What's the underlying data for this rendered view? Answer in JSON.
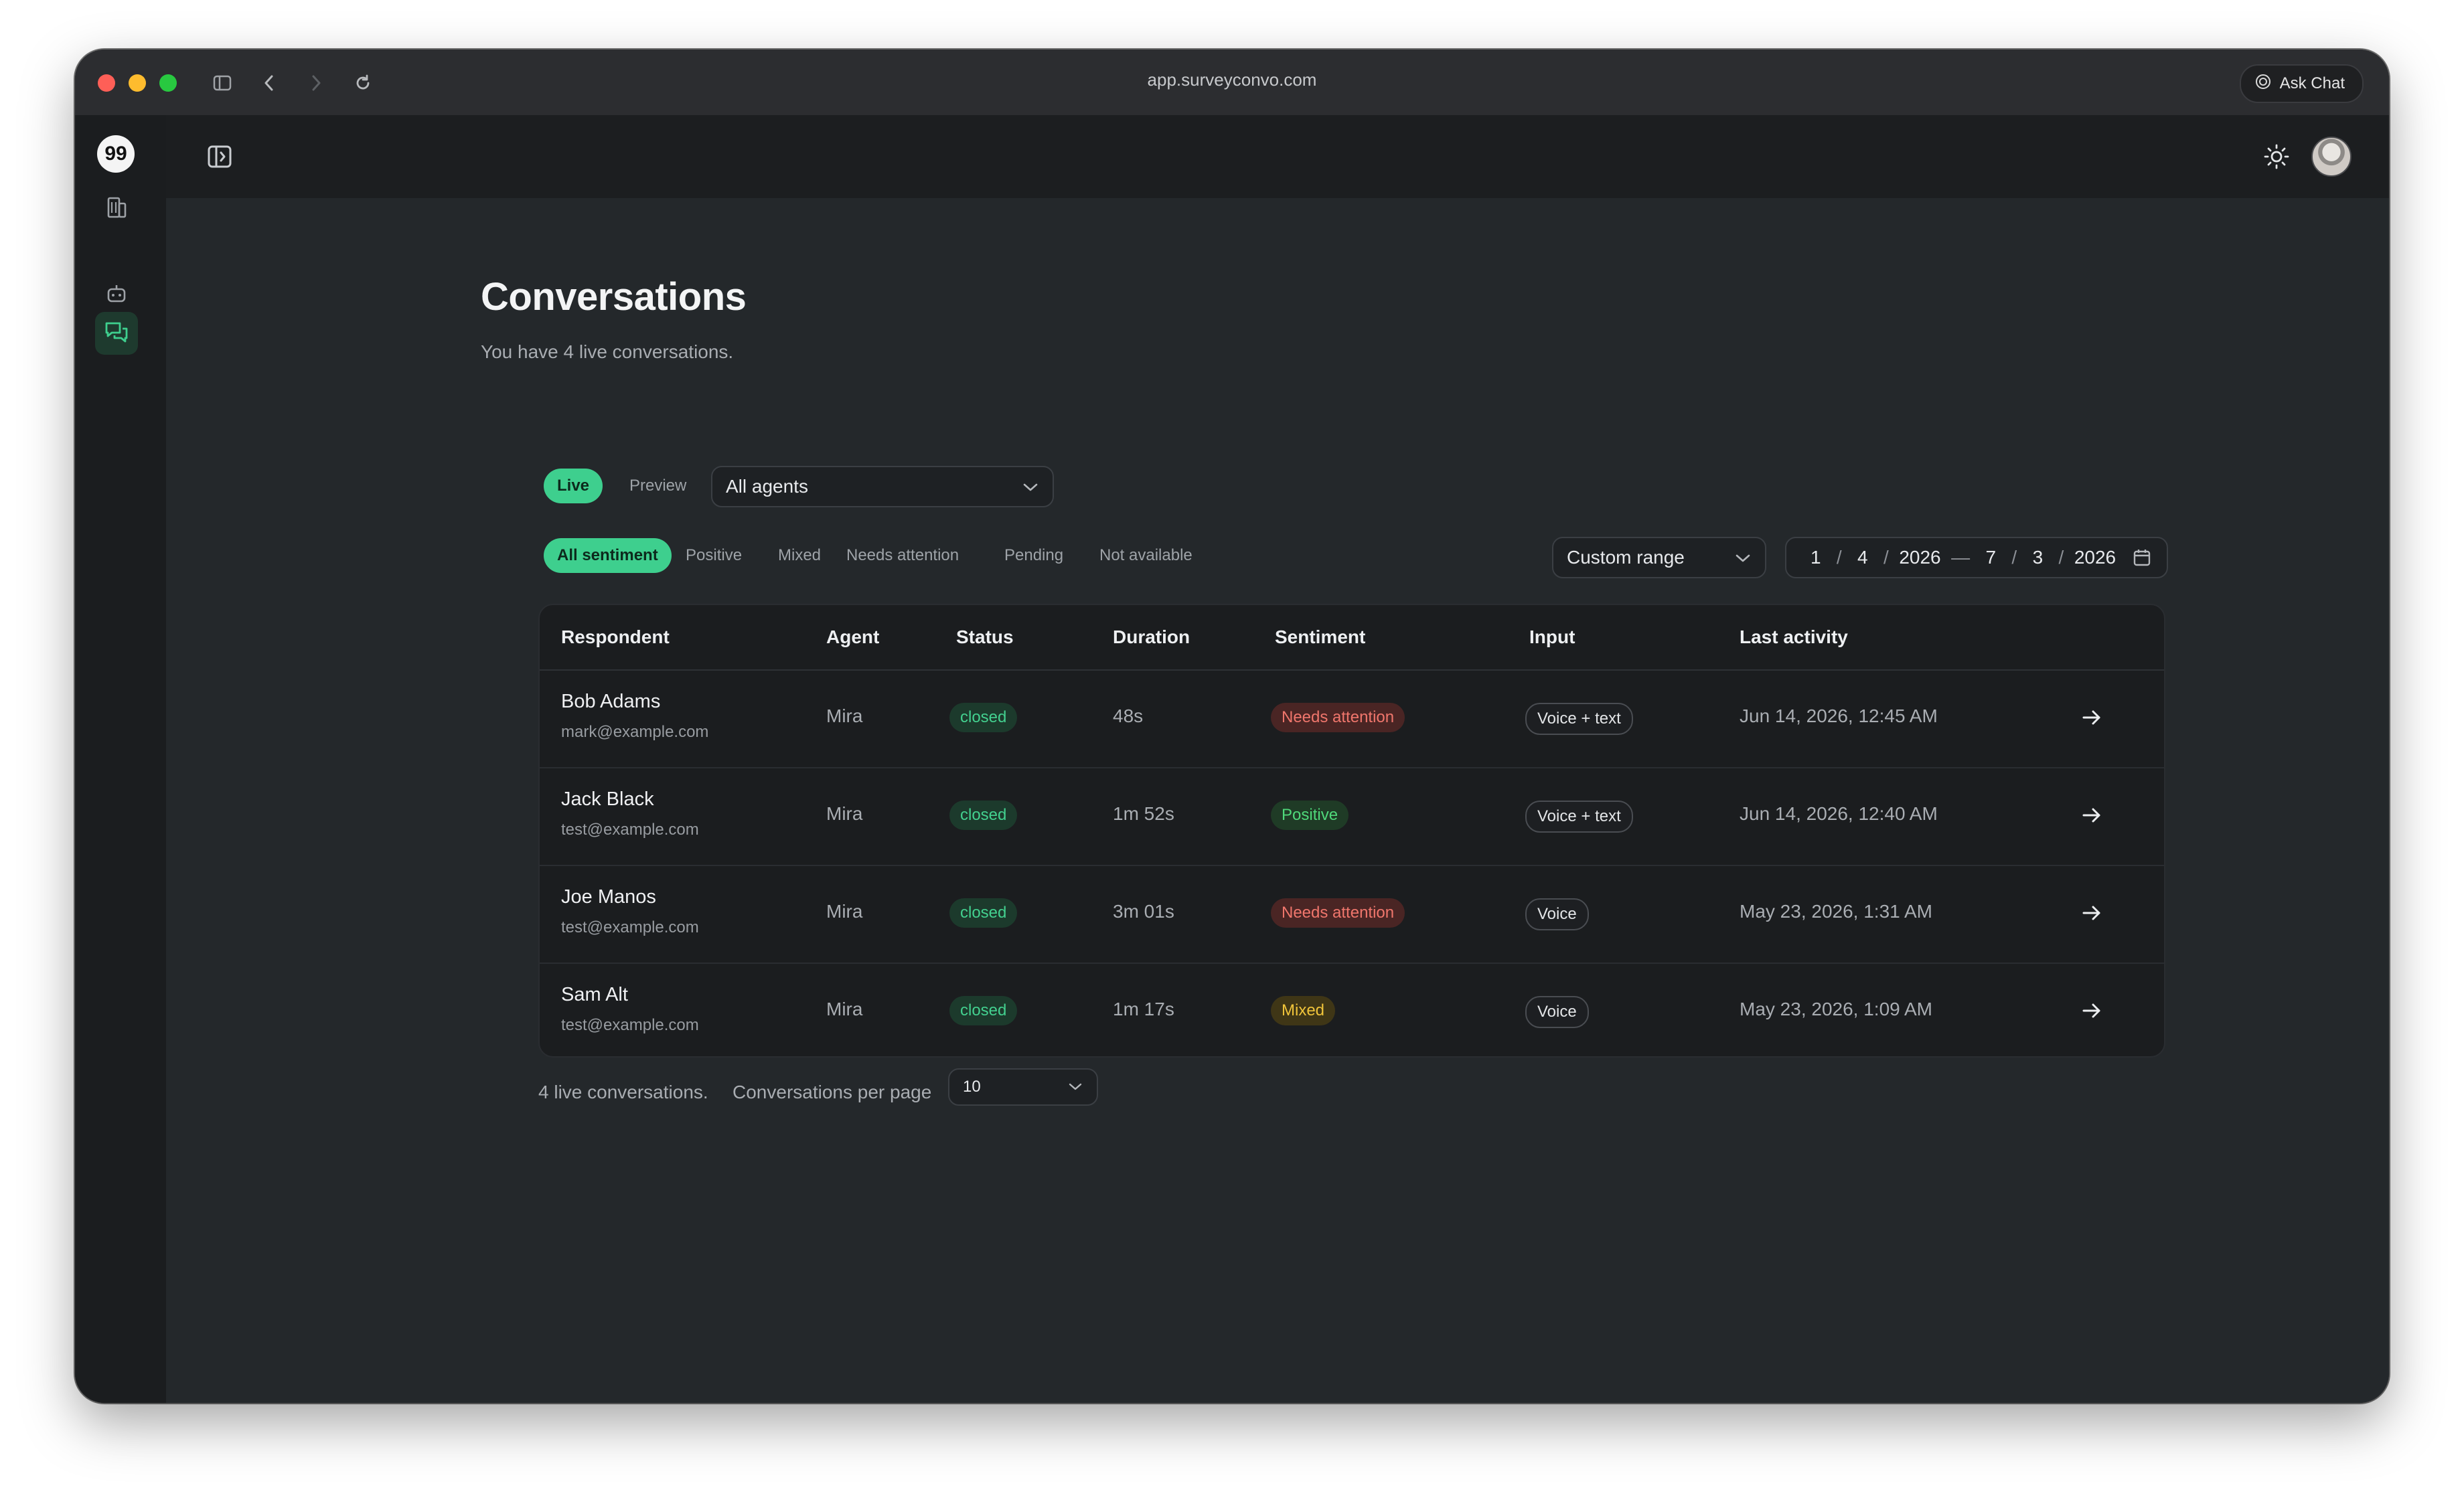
{
  "browser": {
    "url": "app.surveyconvo.com",
    "ask_chat_label": "Ask Chat"
  },
  "sidebar": {
    "logo_text": "99",
    "items": [
      {
        "icon": "building-icon"
      },
      {
        "icon": "bot-icon"
      },
      {
        "icon": "chat-bubbles-icon",
        "active": true
      }
    ]
  },
  "page": {
    "title": "Conversations",
    "subtitle": "You have 4 live conversations."
  },
  "mode_tabs": [
    "Live",
    "Preview"
  ],
  "agent_select": {
    "value": "All agents"
  },
  "sentiment_filters": [
    "All sentiment",
    "Positive",
    "Mixed",
    "Needs attention",
    "Pending",
    "Not available"
  ],
  "range_select": {
    "value": "Custom range"
  },
  "date_range": {
    "start": {
      "month": "1",
      "day": "4",
      "year": "2026"
    },
    "end": {
      "month": "7",
      "day": "3",
      "year": "2026"
    }
  },
  "table": {
    "columns": [
      "Respondent",
      "Agent",
      "Status",
      "Duration",
      "Sentiment",
      "Input",
      "Last activity"
    ],
    "rows": [
      {
        "name": "Bob Adams",
        "email": "mark@example.com",
        "agent": "Mira",
        "status": "closed",
        "duration": "48s",
        "sentiment": "Needs attention",
        "input": "Voice + text",
        "last_activity": "Jun 14, 2026, 12:45 AM"
      },
      {
        "name": "Jack Black",
        "email": "test@example.com",
        "agent": "Mira",
        "status": "closed",
        "duration": "1m 52s",
        "sentiment": "Positive",
        "input": "Voice + text",
        "last_activity": "Jun 14, 2026, 12:40 AM"
      },
      {
        "name": "Joe Manos",
        "email": "test@example.com",
        "agent": "Mira",
        "status": "closed",
        "duration": "3m 01s",
        "sentiment": "Needs attention",
        "input": "Voice",
        "last_activity": "May 23, 2026, 1:31 AM"
      },
      {
        "name": "Sam Alt",
        "email": "test@example.com",
        "agent": "Mira",
        "status": "closed",
        "duration": "1m 17s",
        "sentiment": "Mixed",
        "input": "Voice",
        "last_activity": "May 23, 2026, 1:09 AM"
      }
    ]
  },
  "footer": {
    "count_text": "4 live conversations.",
    "per_page_label": "Conversations per page",
    "per_page_value": "10"
  },
  "colors": {
    "accent": "#3ecf8e",
    "needs_attention": "#f0766c",
    "positive": "#4fd87a",
    "mixed": "#f0c43a"
  }
}
